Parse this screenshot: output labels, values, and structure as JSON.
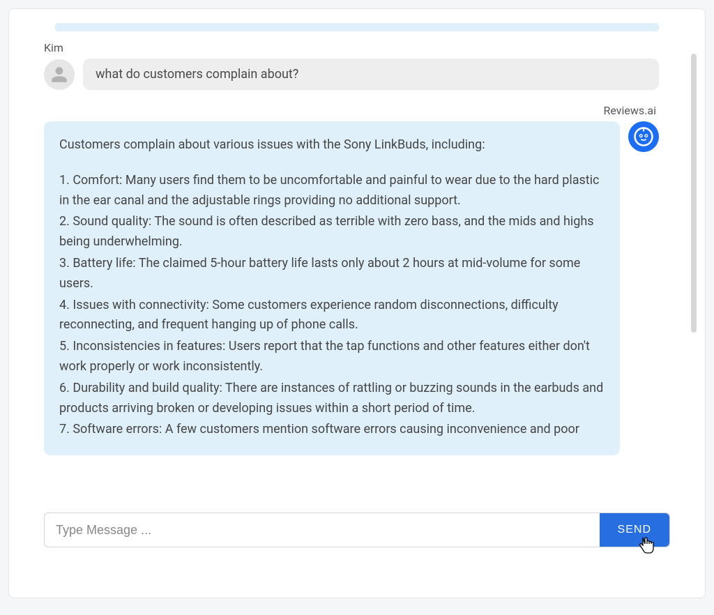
{
  "user": {
    "name": "Kim",
    "message": "what do customers complain about?"
  },
  "bot": {
    "name": "Reviews.ai",
    "intro": "Customers complain about various issues with the Sony LinkBuds, including:",
    "points": [
      "1. Comfort: Many users find them to be uncomfortable and painful to wear due to the hard plastic in the ear canal and the adjustable rings providing no additional support.",
      "2. Sound quality: The sound is often described as terrible with zero bass, and the mids and highs being underwhelming.",
      "3. Battery life: The claimed 5-hour battery life lasts only about 2 hours at mid-volume for some users.",
      "4. Issues with connectivity: Some customers experience random disconnections, difficulty reconnecting, and frequent hanging up of phone calls.",
      "5. Inconsistencies in features: Users report that the tap functions and other features either don't work properly or work inconsistently.",
      "6. Durability and build quality: There are instances of rattling or buzzing sounds in the earbuds and products arriving broken or developing issues within a short period of time.",
      "7. Software errors: A few customers mention software errors causing inconvenience and poor"
    ]
  },
  "input": {
    "placeholder": "Type Message ...",
    "send_label": "SEND"
  }
}
